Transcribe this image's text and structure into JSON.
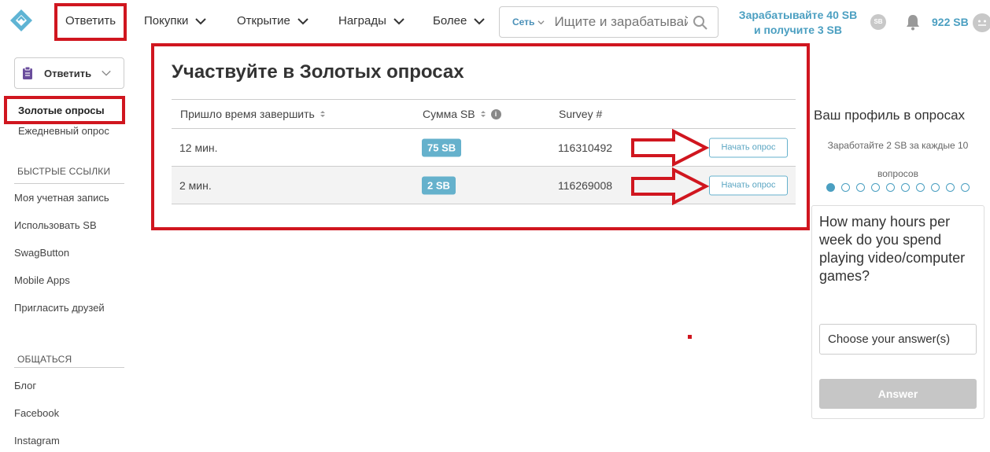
{
  "header": {
    "logo": "swagbucks-logo-icon",
    "nav": [
      {
        "label": "Ответить"
      },
      {
        "label": "Покупки"
      },
      {
        "label": "Открытие"
      },
      {
        "label": "Награды"
      },
      {
        "label": "Более"
      }
    ],
    "search": {
      "scope": "Сеть",
      "placeholder": "Ищите и зарабатывайте"
    },
    "promo_line1": "Зарабатывайте 40 SB",
    "promo_line2": "и получите 3 SB",
    "sb_badge": "SB",
    "balance": "922 SB"
  },
  "sidebar": {
    "dropdown_label": "Ответить",
    "items": [
      {
        "label": "Золотые опросы"
      },
      {
        "label": "Ежедневный опрос"
      }
    ],
    "quick_links_heading": "БЫСТРЫЕ ССЫЛКИ",
    "quick_links": [
      {
        "label": "Моя учетная запись"
      },
      {
        "label": "Использовать SB"
      },
      {
        "label": "SwagButton"
      },
      {
        "label": "Mobile Apps"
      },
      {
        "label": "Пригласить друзей"
      }
    ],
    "social_heading": "ОБЩАТЬСЯ",
    "social": [
      {
        "label": "Блог"
      },
      {
        "label": "Facebook"
      },
      {
        "label": "Instagram"
      }
    ]
  },
  "main": {
    "title": "Участвуйте в Золотых опросах",
    "columns": [
      "Пришло время завершить",
      "Сумма SB",
      "Survey #"
    ],
    "rows": [
      {
        "time": "12 мин.",
        "sb": "75 SB",
        "survey": "116310492",
        "action": "Начать опрос"
      },
      {
        "time": "2 мин.",
        "sb": "2 SB",
        "survey": "116269008",
        "action": "Начать опрос"
      }
    ]
  },
  "profile": {
    "title": "Ваш профиль в опросах",
    "subtitle": "Заработайте 2 SB за каждые 10 вопросов",
    "progress_total": 10,
    "progress_done": 1,
    "question": "How many hours per week do you spend playing video/computer games?",
    "select_placeholder": "Choose your answer(s)",
    "answer_button": "Answer"
  },
  "colors": {
    "accent": "#4b9fc1",
    "annotation_red": "#d0161f",
    "pill": "#65b1cc"
  }
}
